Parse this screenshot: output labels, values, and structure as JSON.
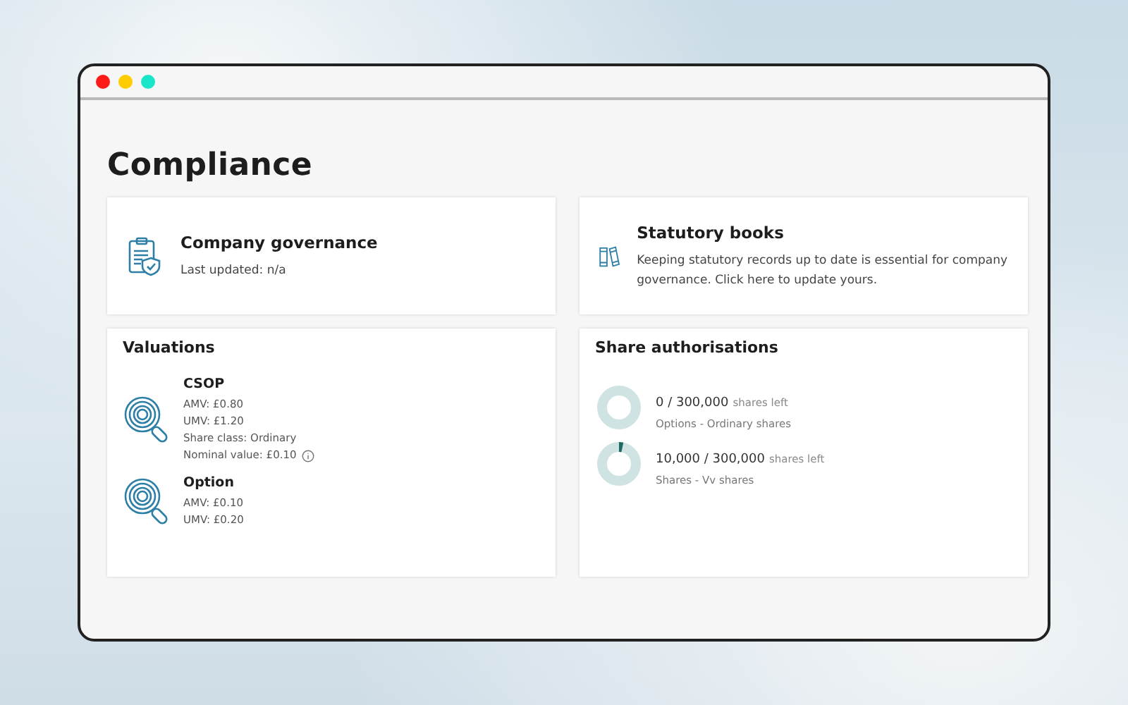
{
  "page": {
    "title": "Compliance"
  },
  "cards": [
    {
      "kind": "governance",
      "title": "Company governance",
      "text": "Last updated: n/a"
    },
    {
      "kind": "books",
      "title": "Statutory books",
      "text": "Keeping statutory records up to date is essential for company governance. Click here to update yours."
    }
  ],
  "valuations": {
    "title": "Valuations",
    "items": [
      {
        "name": "CSOP",
        "lines": [
          "AMV: £0.80",
          "UMV: £1.20",
          "Share class: Ordinary",
          "Nominal value: £0.10"
        ],
        "info": true
      },
      {
        "name": "Option",
        "lines": [
          "AMV: £0.10",
          "UMV: £0.20"
        ],
        "info": false
      }
    ]
  },
  "share_authorisations": {
    "title": "Share authorisations",
    "items": [
      {
        "count": "0 / 300,000",
        "suffix": "shares left",
        "subtitle": "Options - Ordinary shares",
        "level": 0
      },
      {
        "count": "10,000 / 300,000",
        "suffix": "shares left",
        "subtitle": "Shares - Vv shares",
        "level": 0.033
      }
    ]
  }
}
